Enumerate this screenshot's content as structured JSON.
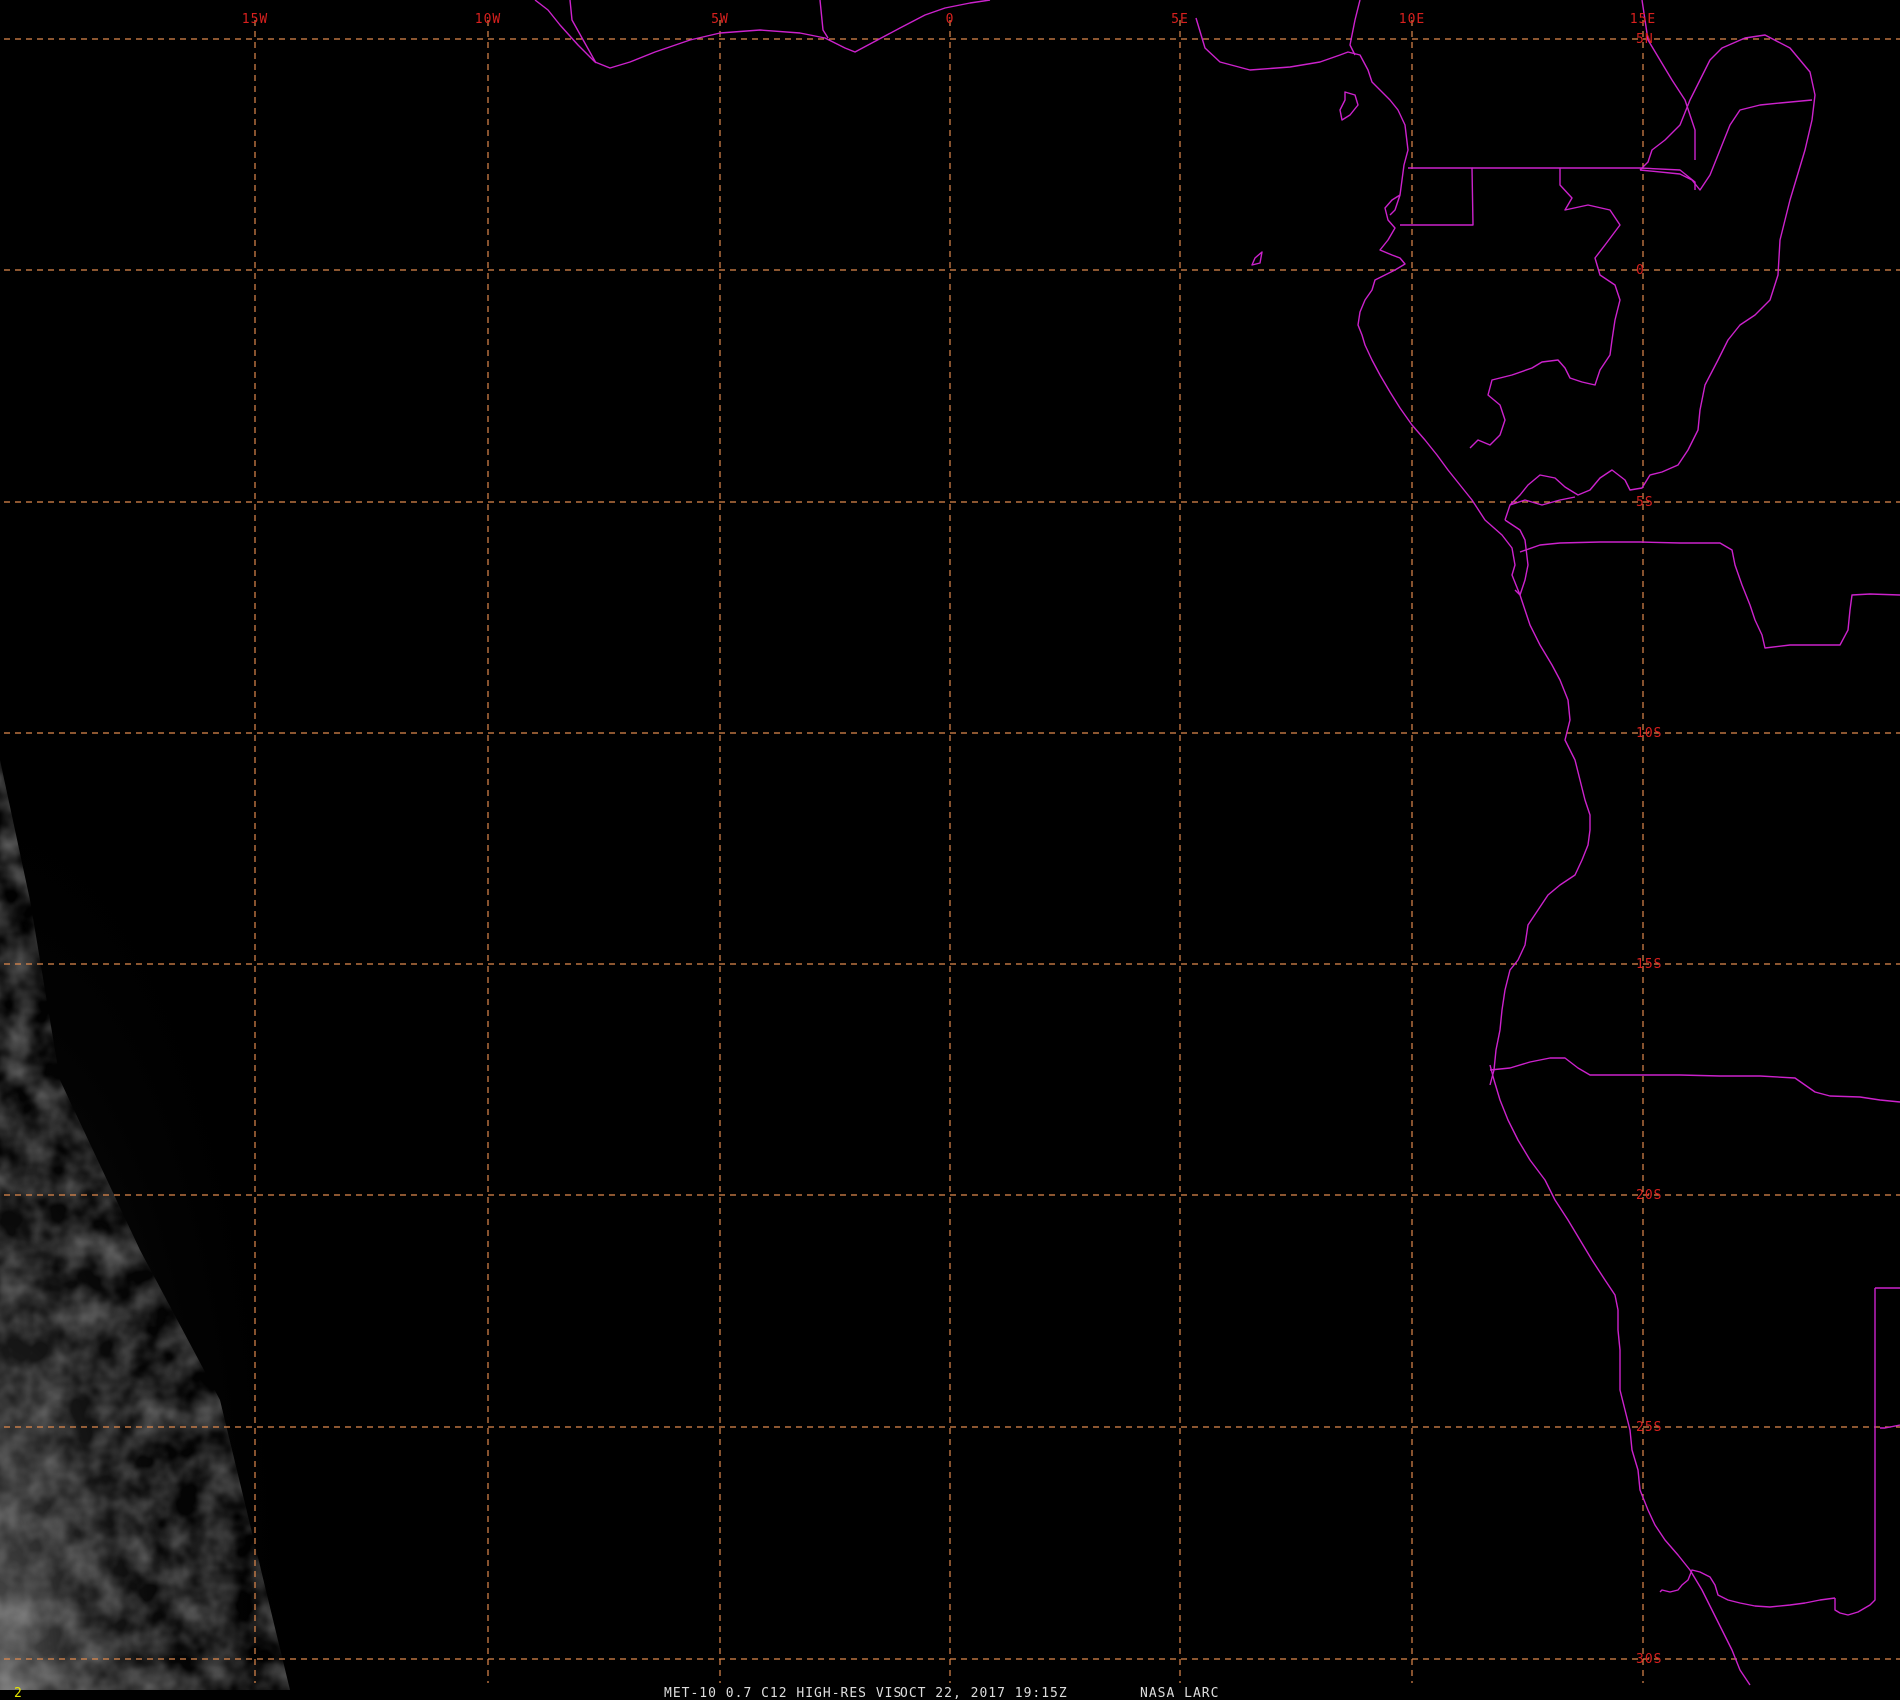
{
  "map": {
    "colors": {
      "background": "#000000",
      "grid": "#e0894c",
      "tick_label": "#d9201e",
      "border": "#cc22cc",
      "footer_text": "#dddddd",
      "frame_number": "#e6e600"
    },
    "longitude_labels": [
      "15W",
      "10W",
      "5W",
      "0",
      "5E",
      "10E",
      "15E"
    ],
    "latitude_labels": [
      "5N",
      "0",
      "5S",
      "10S",
      "15S",
      "20S",
      "25S",
      "30S"
    ],
    "frame_number": "2",
    "footer": {
      "product": "MET-10 0.7 C12 HIGH-RES VIS",
      "datetime": "OCT 22, 2017 19:15Z",
      "credit": "NASA LARC"
    }
  }
}
